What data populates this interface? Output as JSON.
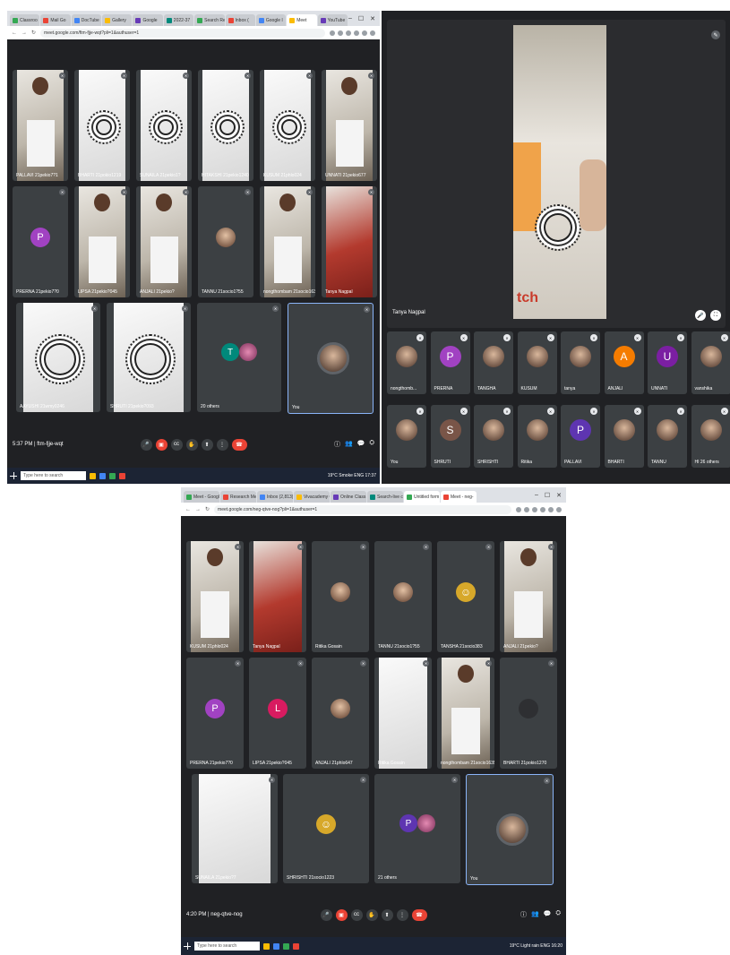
{
  "shot1": {
    "tabs": [
      "Classroo",
      "Mail Go",
      "DocTube",
      "Gallery",
      "Google",
      "2022-37",
      "Search Res",
      "Inbox (",
      "Google I",
      "Meet",
      "YouTube"
    ],
    "url": "meet.google.com/ftm-fjje-wqt?pli=1&authuser=1",
    "tiles": [
      {
        "name": "PALLAVI 21pekio7?1",
        "kind": "person"
      },
      {
        "name": "BHARTI 21pokio1219",
        "kind": "mandala"
      },
      {
        "name": "SUNAILA 21pekio1?",
        "kind": "mandala"
      },
      {
        "name": "HITAKSHI 21pekio1240",
        "kind": "mandala"
      },
      {
        "name": "KUSUM 21phlo024",
        "kind": "mandala"
      },
      {
        "name": "UNNATI 21pekio677",
        "kind": "person"
      },
      {
        "name": "PRERNA 21pekio7?0",
        "kind": "avatar",
        "letter": "P",
        "color": "#a142c2"
      },
      {
        "name": "LIPSA 21pekio?045",
        "kind": "person"
      },
      {
        "name": "ANJALI 21pekio?",
        "kind": "person"
      },
      {
        "name": "TANNU 21socio1?55",
        "kind": "face"
      },
      {
        "name": "nongthombam 21socio1635",
        "kind": "person"
      },
      {
        "name": "Tanya Nagpal",
        "kind": "red"
      },
      {
        "name": "AAYUSHI 21wmy0246",
        "kind": "mandala"
      },
      {
        "name": "SHRUTI 21pekio?093",
        "kind": "mandala"
      },
      {
        "name": "20 others",
        "kind": "others",
        "letter": "T"
      },
      {
        "name": "You",
        "kind": "you"
      }
    ],
    "time_code": "5:37 PM  |  ftm-fjje-wqt",
    "taskbar_search": "Type here to search",
    "tray": "19°C Smoke  ENG  17:37"
  },
  "shot2": {
    "presenter": "Tanya Nagpal",
    "row1": [
      {
        "name": "nongthomb..."
      },
      {
        "name": "PRERNA",
        "letter": "P",
        "color": "#a142c2"
      },
      {
        "name": "TANGHA"
      },
      {
        "name": "KUSUM"
      },
      {
        "name": "tanya"
      },
      {
        "name": "ANJALI",
        "letter": "A",
        "color": "#f57c00"
      },
      {
        "name": "UNNATI",
        "letter": "U",
        "color": "#7b1fa2"
      },
      {
        "name": "vanshika"
      }
    ],
    "row2": [
      {
        "name": "You"
      },
      {
        "name": "SHRUTI",
        "letter": "S",
        "color": "#795548"
      },
      {
        "name": "SHRISHTI"
      },
      {
        "name": "Ritika"
      },
      {
        "name": "PALLAVI",
        "letter": "P",
        "color": "#5e35b1"
      },
      {
        "name": "BHARTI"
      },
      {
        "name": "TANNU"
      },
      {
        "name": "HI  26 others"
      }
    ]
  },
  "shot3": {
    "tabs": [
      "Meet - Google Cl",
      "Research Methd",
      "Inbox (2,813)",
      "Vivacademy Cl",
      "Online Class mee",
      "Search-live class",
      "Untitled form",
      "Meet - neg-"
    ],
    "url": "meet.google.com/neg-qtve-nog?pli=1&authuser=1",
    "tiles": [
      {
        "name": "KUSUM 21phlo024",
        "kind": "person"
      },
      {
        "name": "Tanya Nagpal",
        "kind": "red"
      },
      {
        "name": "Ritika Gosain",
        "kind": "face"
      },
      {
        "name": "TANNU 21socio1?55",
        "kind": "face"
      },
      {
        "name": "TANSHA 21socio383",
        "kind": "emoji"
      },
      {
        "name": "ANJALI 21pekio?",
        "kind": "person"
      },
      {
        "name": "PRERNA 21pekio7?0",
        "kind": "avatar",
        "letter": "P",
        "color": "#a142c2"
      },
      {
        "name": "LIPSA 21pekio?045",
        "kind": "avatar",
        "letter": "L",
        "color": "#d81b60"
      },
      {
        "name": "ANJALI 21phlo647",
        "kind": "face"
      },
      {
        "name": "Ritika Gosain",
        "kind": "white"
      },
      {
        "name": "nongthombam 21socio1635",
        "kind": "person"
      },
      {
        "name": "BHARTI 21pokio1270",
        "kind": "blank"
      },
      {
        "name": "SUNAILA 21pekio?7",
        "kind": "white"
      },
      {
        "name": "SHRISHTI 21socio1223",
        "kind": "emoji"
      },
      {
        "name": "21 others",
        "kind": "others",
        "letter": "P"
      },
      {
        "name": "You",
        "kind": "you"
      }
    ],
    "time_code": "4:20 PM  |  neg-qtve-nog",
    "taskbar_search": "Type here to search",
    "tray": "19°C Light rain  ENG  16:20"
  }
}
